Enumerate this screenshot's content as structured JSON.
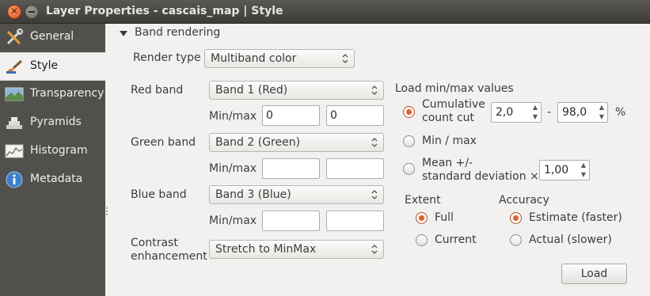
{
  "window": {
    "title": "Layer Properties - cascais_map | Style"
  },
  "sidebar": {
    "items": [
      {
        "label": "General",
        "icon": "wrench-icon"
      },
      {
        "label": "Style",
        "icon": "paintbrush-icon",
        "active": true
      },
      {
        "label": "Transparency",
        "icon": "transparency-icon"
      },
      {
        "label": "Pyramids",
        "icon": "pyramids-icon"
      },
      {
        "label": "Histogram",
        "icon": "histogram-icon"
      },
      {
        "label": "Metadata",
        "icon": "info-icon"
      }
    ]
  },
  "band_rendering": {
    "section_label": "Band rendering",
    "render_type": {
      "label": "Render type",
      "value": "Multiband color"
    },
    "red_band": {
      "label": "Red band",
      "value": "Band 1 (Red)",
      "minmax_label": "Min/max",
      "min": "0",
      "max": "0"
    },
    "green_band": {
      "label": "Green band",
      "value": "Band 2 (Green)",
      "minmax_label": "Min/max",
      "min": "",
      "max": ""
    },
    "blue_band": {
      "label": "Blue band",
      "value": "Band 3 (Blue)",
      "minmax_label": "Min/max",
      "min": "",
      "max": ""
    },
    "contrast": {
      "label_line1": "Contrast",
      "label_line2": "enhancement",
      "value": "Stretch to MinMax"
    }
  },
  "load_minmax": {
    "title": "Load min/max values",
    "cumulative": {
      "line1": "Cumulative",
      "line2": "count cut",
      "low": "2,0",
      "high": "98,0",
      "separator": "-",
      "unit": "%",
      "selected": true
    },
    "minmax": {
      "label": "Min / max",
      "selected": false
    },
    "stddev": {
      "line1": "Mean +/-",
      "line2": "standard deviation ×",
      "value": "1,00",
      "selected": false
    },
    "extent": {
      "title": "Extent",
      "full": "Full",
      "current": "Current",
      "selected": "Full"
    },
    "accuracy": {
      "title": "Accuracy",
      "estimate": "Estimate (faster)",
      "actual": "Actual (slower)",
      "selected": "Estimate (faster)"
    },
    "load_button": "Load"
  },
  "colors": {
    "sidebar_bg": "#52504c",
    "accent": "#e0622b",
    "titlebar": "#3d3c39"
  }
}
